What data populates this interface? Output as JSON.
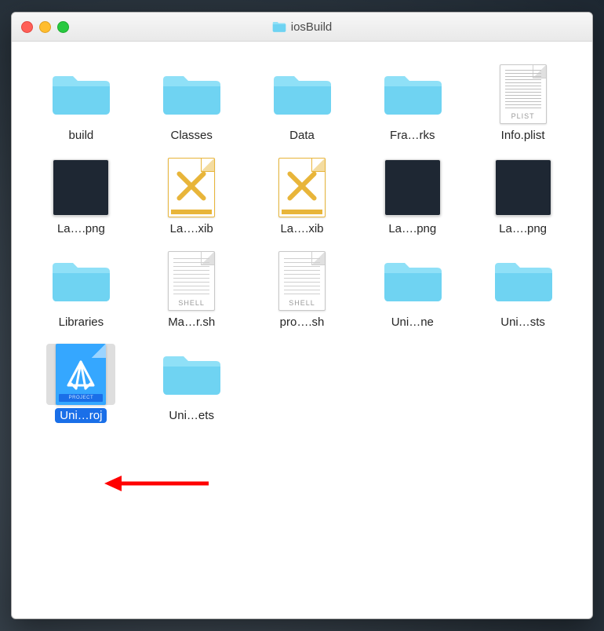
{
  "window": {
    "title": "iosBuild"
  },
  "items": [
    {
      "name": "build",
      "type": "folder"
    },
    {
      "name": "Classes",
      "type": "folder"
    },
    {
      "name": "Data",
      "type": "folder"
    },
    {
      "name": "Fra…rks",
      "type": "folder"
    },
    {
      "name": "Info.plist",
      "type": "plist",
      "tag": "PLIST"
    },
    {
      "name": "La….png",
      "type": "png"
    },
    {
      "name": "La….xib",
      "type": "xib"
    },
    {
      "name": "La….xib",
      "type": "xib"
    },
    {
      "name": "La….png",
      "type": "png"
    },
    {
      "name": "La….png",
      "type": "png"
    },
    {
      "name": "Libraries",
      "type": "folder"
    },
    {
      "name": "Ma…r.sh",
      "type": "shell",
      "tag": "SHELL"
    },
    {
      "name": "pro….sh",
      "type": "shell",
      "tag": "SHELL"
    },
    {
      "name": "Uni…ne",
      "type": "folder"
    },
    {
      "name": "Uni…sts",
      "type": "folder"
    },
    {
      "name": "Uni…roj",
      "type": "xcodeproj",
      "tag": "PROJECT",
      "selected": true
    },
    {
      "name": "Uni…ets",
      "type": "folder"
    }
  ],
  "annotation": {
    "arrow_target_index": 15
  }
}
